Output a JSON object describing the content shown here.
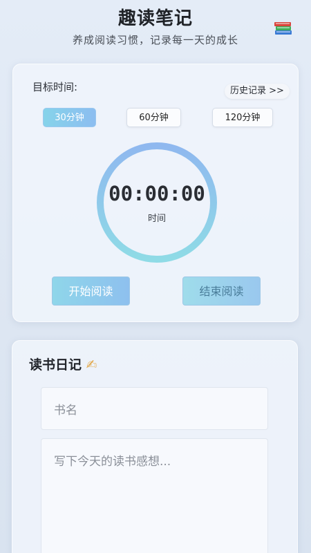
{
  "header": {
    "title": "趣读笔记",
    "subtitle": "养成阅读习惯，记录每一天的成长",
    "icon": "books-icon"
  },
  "timer_card": {
    "target_label": "目标时间:",
    "history_link": "历史记录 >>",
    "durations": [
      {
        "label": "30分钟",
        "selected": true
      },
      {
        "label": "60分钟",
        "selected": false
      },
      {
        "label": "120分钟",
        "selected": false
      }
    ],
    "display": "00:00:00",
    "caption": "时间",
    "start_label": "开始阅读",
    "end_label": "结束阅读",
    "accent_colors": [
      "#86d3ea",
      "#8cbdf0"
    ]
  },
  "journal": {
    "title": "读书日记",
    "title_icon": "✍",
    "book_name_placeholder": "书名",
    "thoughts_placeholder": "写下今天的读书感想..."
  }
}
